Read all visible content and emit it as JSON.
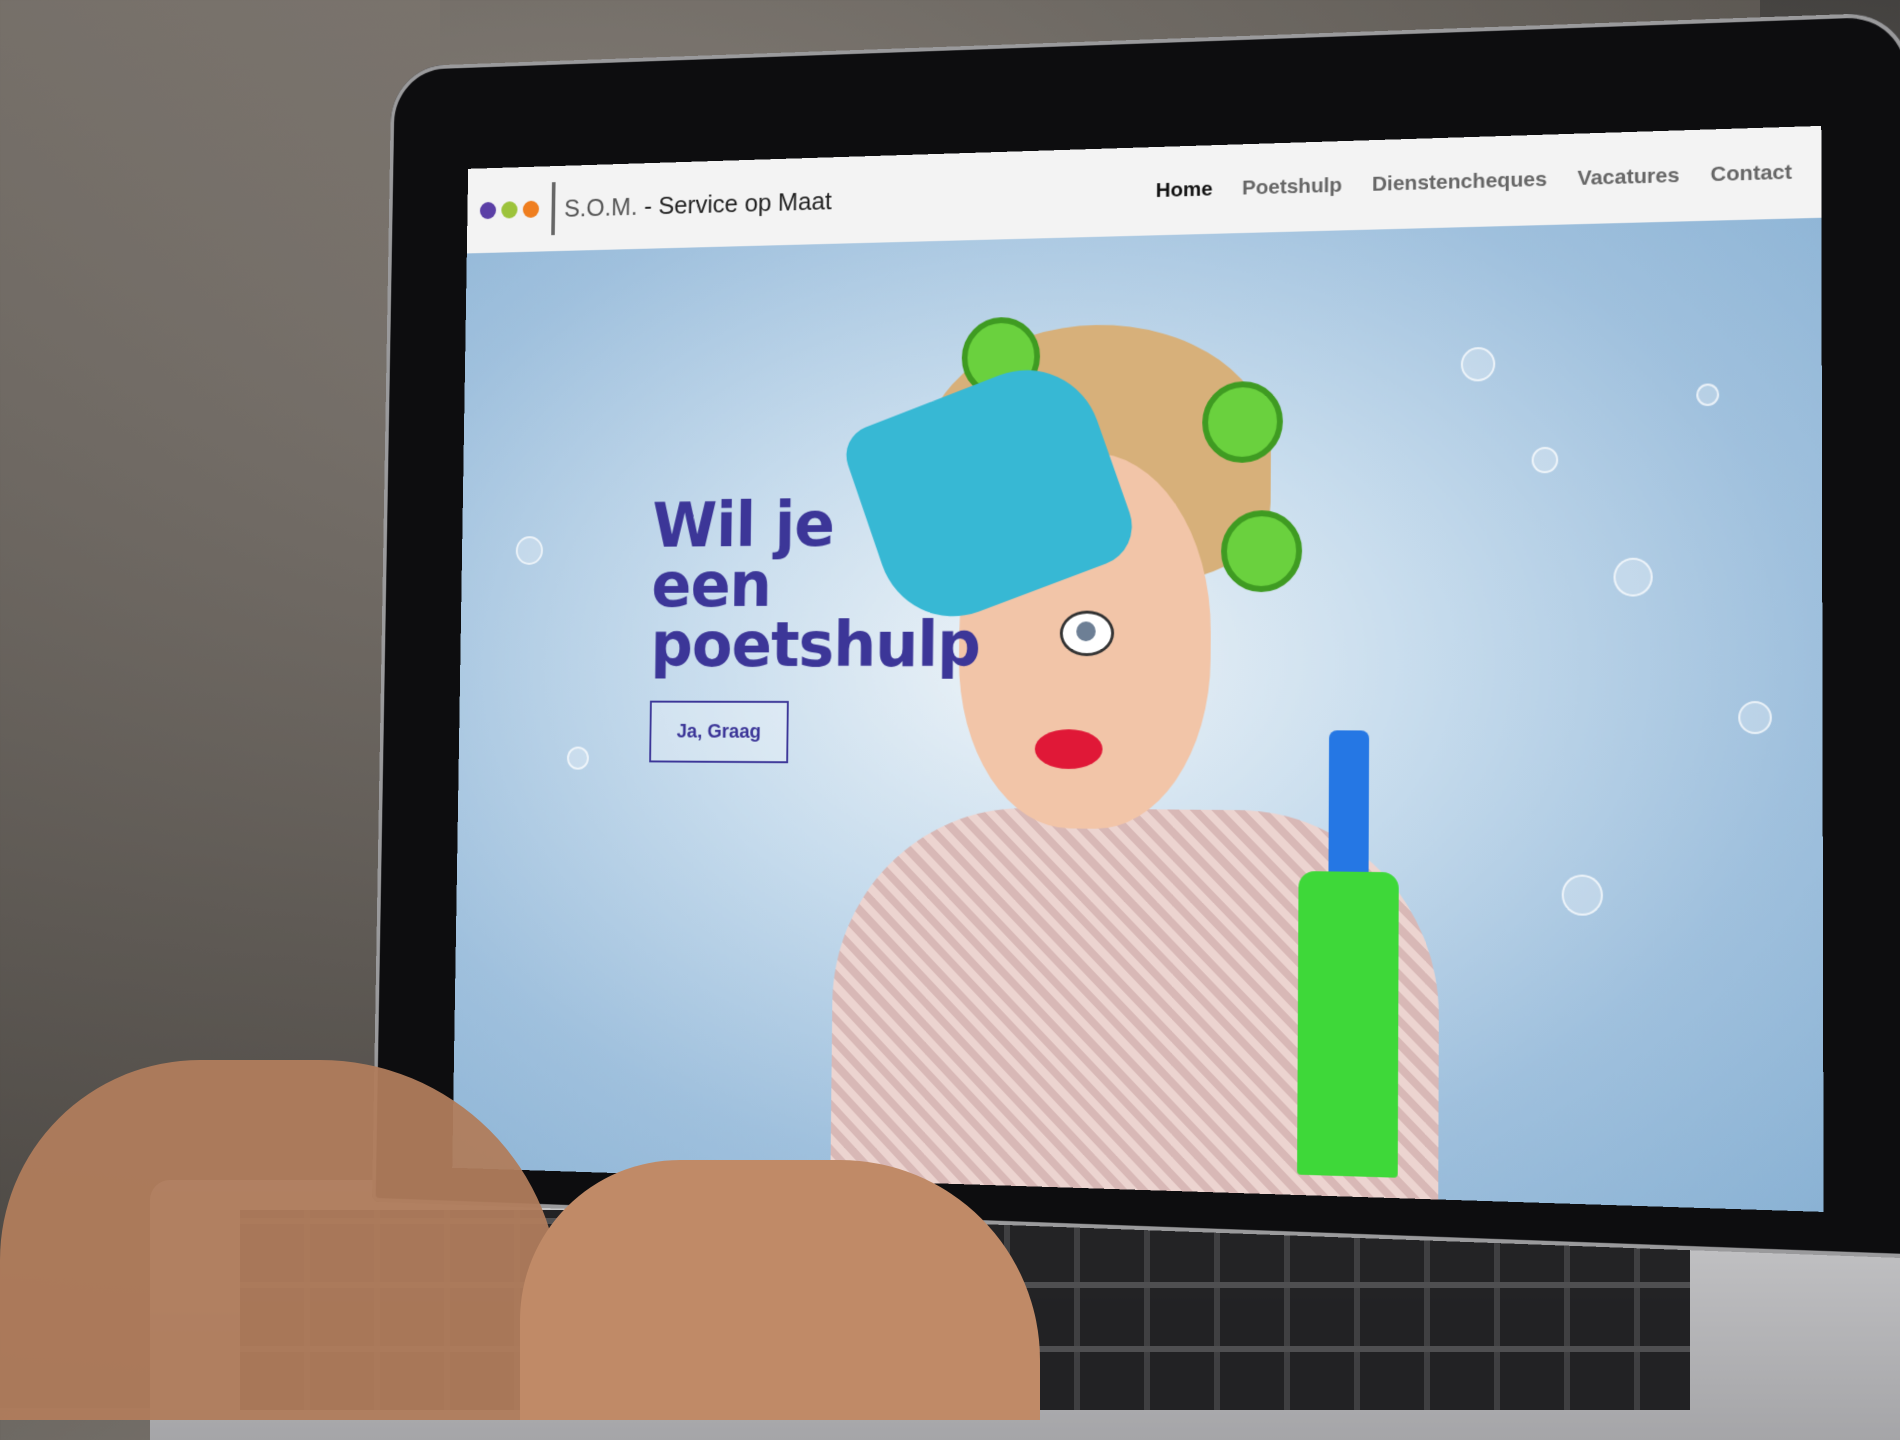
{
  "site": {
    "logo": {
      "abbr": "S.O.M.",
      "text": "- Service op Maat",
      "dot_colors": [
        "#5b3fa6",
        "#9cc33b",
        "#ef7e1f"
      ]
    },
    "nav": [
      {
        "label": "Home",
        "active": true
      },
      {
        "label": "Poetshulp",
        "active": false
      },
      {
        "label": "Dienstencheques",
        "active": false
      },
      {
        "label": "Vacatures",
        "active": false
      },
      {
        "label": "Contact",
        "active": false
      }
    ],
    "hero": {
      "title": "Wil je een poetshulp",
      "cta_label": "Ja, Graag"
    }
  },
  "colors": {
    "accent": "#3c3698",
    "nav_background": "#f3f3f3"
  }
}
